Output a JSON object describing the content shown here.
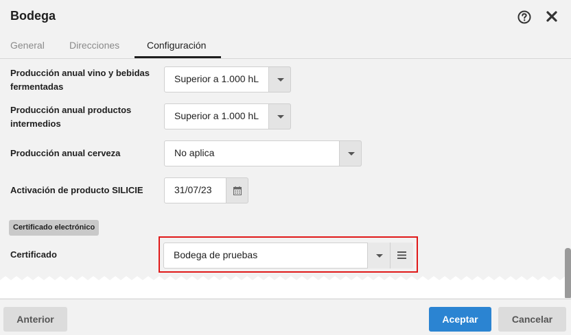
{
  "dialog": {
    "title": "Bodega",
    "help_icon": "question-circle-icon",
    "close_icon": "close-x-icon"
  },
  "tabs": [
    {
      "label": "General",
      "active": false
    },
    {
      "label": "Direcciones",
      "active": false
    },
    {
      "label": "Configuración",
      "active": true
    }
  ],
  "form": {
    "fields": [
      {
        "label": "Producción anual vino y bebidas fermentadas",
        "value": "Superior a 1.000 hL"
      },
      {
        "label": "Producción anual productos intermedios",
        "value": "Superior a 1.000 hL"
      },
      {
        "label": "Producción anual cerveza",
        "value": "No aplica"
      },
      {
        "label": "Activación de producto SILICIE",
        "value": "31/07/23"
      }
    ],
    "section_badge": "Certificado electrónico",
    "certificate": {
      "label": "Certificado",
      "value": "Bodega de pruebas"
    }
  },
  "footer": {
    "prev_label": "Anterior",
    "ok_label": "Aceptar",
    "cancel_label": "Cancelar"
  },
  "colors": {
    "accent": "#2b84d2",
    "highlight": "#e01818"
  }
}
